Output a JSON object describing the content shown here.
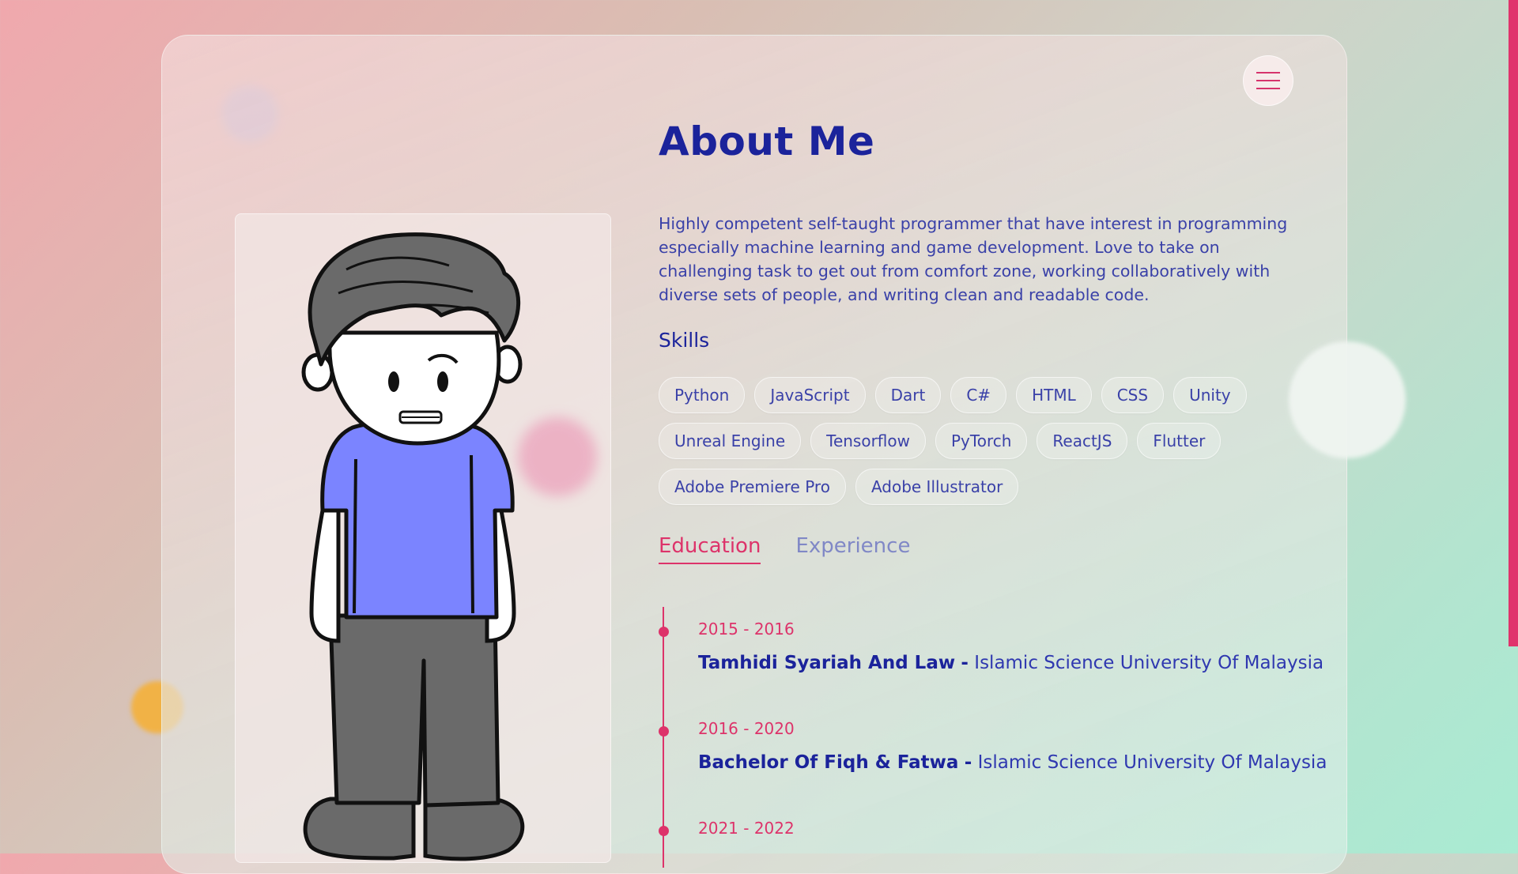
{
  "page": {
    "title": "About Me",
    "bio": "Highly competent self-taught programmer that have interest in programming especially machine learning and game development. Love to take on challenging task to get out from comfort zone, working collaboratively with diverse sets of people, and writing clean and readable code."
  },
  "menu": {
    "icon": "hamburger-menu-icon"
  },
  "skills": {
    "title": "Skills",
    "items": [
      "Python",
      "JavaScript",
      "Dart",
      "C#",
      "HTML",
      "CSS",
      "Unity",
      "Unreal Engine",
      "Tensorflow",
      "PyTorch",
      "ReactJS",
      "Flutter",
      "Adobe Premiere Pro",
      "Adobe Illustrator"
    ]
  },
  "tabs": [
    {
      "label": "Education",
      "active": true
    },
    {
      "label": "Experience",
      "active": false
    }
  ],
  "timeline": [
    {
      "years": "2015 - 2016",
      "degree": "Tamhidi Syariah And Law",
      "separator": "-",
      "institution": "Islamic Science University Of Malaysia"
    },
    {
      "years": "2016 - 2020",
      "degree": "Bachelor Of Fiqh & Fatwa",
      "separator": "-",
      "institution": "Islamic Science University Of Malaysia"
    },
    {
      "years": "2021 - 2022",
      "degree": "",
      "separator": "",
      "institution": ""
    }
  ],
  "colors": {
    "accent": "#dd336a",
    "heading": "#1b239b",
    "text": "#3a41a8",
    "shirt": "#7b84ff",
    "pants": "#6a6a6a"
  }
}
